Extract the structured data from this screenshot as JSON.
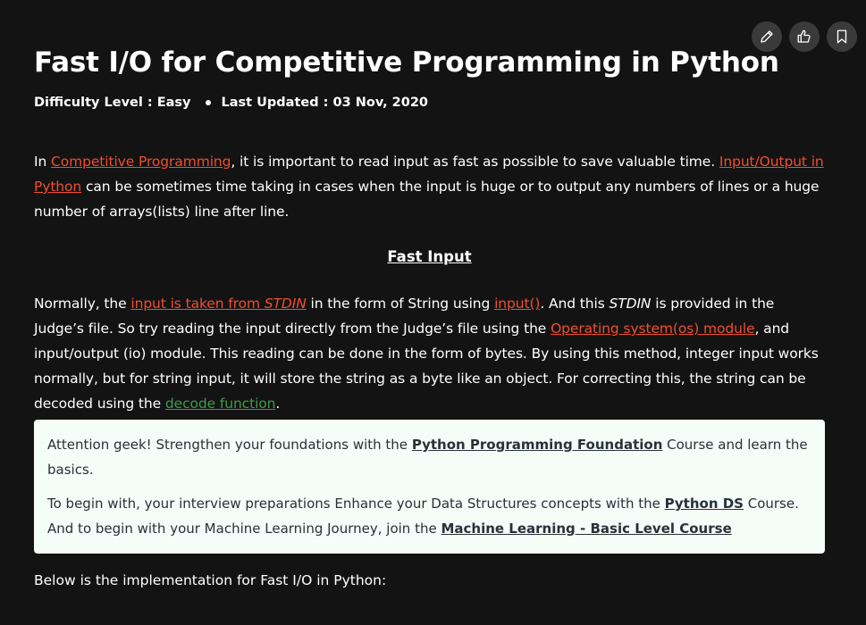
{
  "toolbar": {
    "edit_icon": "pencil-icon",
    "like_icon": "thumbs-up-icon",
    "bookmark_icon": "bookmark-icon"
  },
  "article": {
    "title": "Fast I/O for Competitive Programming in Python",
    "difficulty": "Difficulty Level : Easy",
    "updated": "Last Updated : 03 Nov, 2020"
  },
  "intro": {
    "t1": "In ",
    "link1": "Competitive Programming",
    "t2": ", it is important to read input as fast as possible to save valuable time. ",
    "link2": "Input/Output in Python",
    "t3": " can be sometimes time taking in cases when the input is huge or to output any numbers of lines or a huge number of arrays(lists) line after line."
  },
  "section_heading": "Fast Input",
  "fast_input": {
    "t1": "Normally, the ",
    "link1": "input is taken from ",
    "link1_italic": "STDIN",
    "t2": " in the form of String using ",
    "link2": "input()",
    "t3": ". And this ",
    "italic1": "STDIN",
    "t4": " is provided in the Judge’s file. So try reading the input directly from the Judge’s file using the ",
    "link3": "Operating system(os) module",
    "t5": ", and input/output (io) module. This reading can be done in the form of bytes. By using this method, integer input works normally, but for string input, it will store the string as a byte like an object. For correcting this, the string can be decoded using the ",
    "link4": "decode function",
    "t6": "."
  },
  "notice": {
    "p1_t1": " Attention geek! Strengthen your foundations with the ",
    "p1_link": "Python Programming Foundation",
    "p1_t2": " Course and learn the basics.",
    "p2_t1": "To begin with, your interview preparations Enhance your Data Structures concepts with the ",
    "p2_link1": "Python DS",
    "p2_t2": " Course. And to begin with your Machine Learning Journey, join the ",
    "p2_link2": "Machine Learning - Basic Level Course"
  },
  "outro": "Below is the implementation for Fast I/O in Python:"
}
